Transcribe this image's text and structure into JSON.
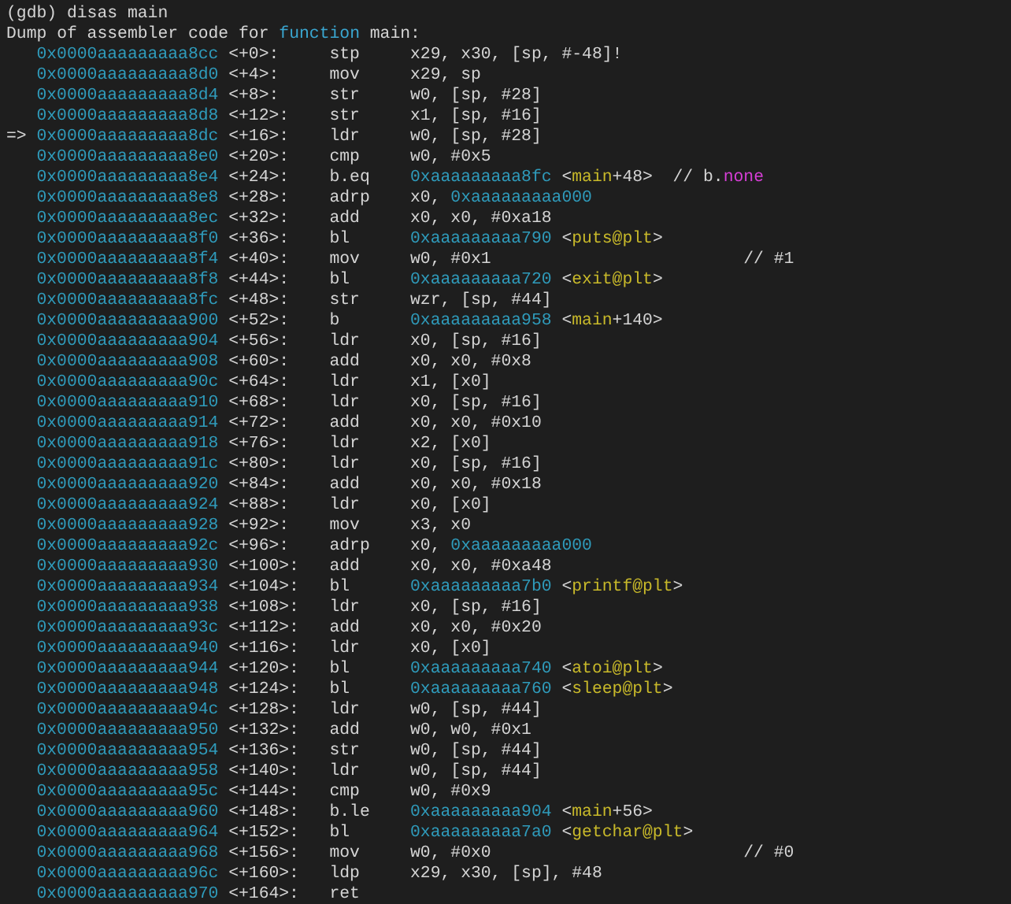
{
  "prompt": "(gdb) disas main",
  "header": [
    {
      "kind": "plain",
      "text": "Dump of assembler code for "
    },
    {
      "kind": "keyword",
      "text": "function"
    },
    {
      "kind": "plain",
      "text": " main:"
    }
  ],
  "instructions": [
    {
      "address": "0x0000aaaaaaaaa8cc",
      "offset": "<+0>:",
      "mnemonic": "stp",
      "operands": [
        {
          "kind": "plain",
          "text": "x29, x30, [sp, #-48]!"
        }
      ]
    },
    {
      "address": "0x0000aaaaaaaaa8d0",
      "offset": "<+4>:",
      "mnemonic": "mov",
      "operands": [
        {
          "kind": "plain",
          "text": "x29, sp"
        }
      ]
    },
    {
      "address": "0x0000aaaaaaaaa8d4",
      "offset": "<+8>:",
      "mnemonic": "str",
      "operands": [
        {
          "kind": "plain",
          "text": "w0, [sp, #28]"
        }
      ]
    },
    {
      "address": "0x0000aaaaaaaaa8d8",
      "offset": "<+12>:",
      "mnemonic": "str",
      "operands": [
        {
          "kind": "plain",
          "text": "x1, [sp, #16]"
        }
      ]
    },
    {
      "pointer": "=>",
      "address": "0x0000aaaaaaaaa8dc",
      "offset": "<+16>:",
      "mnemonic": "ldr",
      "operands": [
        {
          "kind": "plain",
          "text": "w0, [sp, #28]"
        }
      ]
    },
    {
      "address": "0x0000aaaaaaaaa8e0",
      "offset": "<+20>:",
      "mnemonic": "cmp",
      "operands": [
        {
          "kind": "plain",
          "text": "w0, #0x5"
        }
      ]
    },
    {
      "address": "0x0000aaaaaaaaa8e4",
      "offset": "<+24>:",
      "mnemonic": "b.eq",
      "operands": [
        {
          "kind": "address",
          "text": "0xaaaaaaaaa8fc"
        },
        {
          "kind": "plain",
          "text": " <"
        },
        {
          "kind": "symbol",
          "text": "main"
        },
        {
          "kind": "plain",
          "text": "+48>  // b."
        },
        {
          "kind": "condition",
          "text": "none"
        }
      ]
    },
    {
      "address": "0x0000aaaaaaaaa8e8",
      "offset": "<+28>:",
      "mnemonic": "adrp",
      "operands": [
        {
          "kind": "plain",
          "text": "x0, "
        },
        {
          "kind": "address",
          "text": "0xaaaaaaaaa000"
        }
      ]
    },
    {
      "address": "0x0000aaaaaaaaa8ec",
      "offset": "<+32>:",
      "mnemonic": "add",
      "operands": [
        {
          "kind": "plain",
          "text": "x0, x0, #0xa18"
        }
      ]
    },
    {
      "address": "0x0000aaaaaaaaa8f0",
      "offset": "<+36>:",
      "mnemonic": "bl",
      "operands": [
        {
          "kind": "address",
          "text": "0xaaaaaaaaa790"
        },
        {
          "kind": "plain",
          "text": " <"
        },
        {
          "kind": "symbol",
          "text": "puts@plt"
        },
        {
          "kind": "plain",
          "text": ">"
        }
      ]
    },
    {
      "address": "0x0000aaaaaaaaa8f4",
      "offset": "<+40>:",
      "mnemonic": "mov",
      "operands": [
        {
          "kind": "plain",
          "text": "w0, #0x1                         // #1"
        }
      ]
    },
    {
      "address": "0x0000aaaaaaaaa8f8",
      "offset": "<+44>:",
      "mnemonic": "bl",
      "operands": [
        {
          "kind": "address",
          "text": "0xaaaaaaaaa720"
        },
        {
          "kind": "plain",
          "text": " <"
        },
        {
          "kind": "symbol",
          "text": "exit@plt"
        },
        {
          "kind": "plain",
          "text": ">"
        }
      ]
    },
    {
      "address": "0x0000aaaaaaaaa8fc",
      "offset": "<+48>:",
      "mnemonic": "str",
      "operands": [
        {
          "kind": "plain",
          "text": "wzr, [sp, #44]"
        }
      ]
    },
    {
      "address": "0x0000aaaaaaaaa900",
      "offset": "<+52>:",
      "mnemonic": "b",
      "operands": [
        {
          "kind": "address",
          "text": "0xaaaaaaaaa958"
        },
        {
          "kind": "plain",
          "text": " <"
        },
        {
          "kind": "symbol",
          "text": "main"
        },
        {
          "kind": "plain",
          "text": "+140>"
        }
      ]
    },
    {
      "address": "0x0000aaaaaaaaa904",
      "offset": "<+56>:",
      "mnemonic": "ldr",
      "operands": [
        {
          "kind": "plain",
          "text": "x0, [sp, #16]"
        }
      ]
    },
    {
      "address": "0x0000aaaaaaaaa908",
      "offset": "<+60>:",
      "mnemonic": "add",
      "operands": [
        {
          "kind": "plain",
          "text": "x0, x0, #0x8"
        }
      ]
    },
    {
      "address": "0x0000aaaaaaaaa90c",
      "offset": "<+64>:",
      "mnemonic": "ldr",
      "operands": [
        {
          "kind": "plain",
          "text": "x1, [x0]"
        }
      ]
    },
    {
      "address": "0x0000aaaaaaaaa910",
      "offset": "<+68>:",
      "mnemonic": "ldr",
      "operands": [
        {
          "kind": "plain",
          "text": "x0, [sp, #16]"
        }
      ]
    },
    {
      "address": "0x0000aaaaaaaaa914",
      "offset": "<+72>:",
      "mnemonic": "add",
      "operands": [
        {
          "kind": "plain",
          "text": "x0, x0, #0x10"
        }
      ]
    },
    {
      "address": "0x0000aaaaaaaaa918",
      "offset": "<+76>:",
      "mnemonic": "ldr",
      "operands": [
        {
          "kind": "plain",
          "text": "x2, [x0]"
        }
      ]
    },
    {
      "address": "0x0000aaaaaaaaa91c",
      "offset": "<+80>:",
      "mnemonic": "ldr",
      "operands": [
        {
          "kind": "plain",
          "text": "x0, [sp, #16]"
        }
      ]
    },
    {
      "address": "0x0000aaaaaaaaa920",
      "offset": "<+84>:",
      "mnemonic": "add",
      "operands": [
        {
          "kind": "plain",
          "text": "x0, x0, #0x18"
        }
      ]
    },
    {
      "address": "0x0000aaaaaaaaa924",
      "offset": "<+88>:",
      "mnemonic": "ldr",
      "operands": [
        {
          "kind": "plain",
          "text": "x0, [x0]"
        }
      ]
    },
    {
      "address": "0x0000aaaaaaaaa928",
      "offset": "<+92>:",
      "mnemonic": "mov",
      "operands": [
        {
          "kind": "plain",
          "text": "x3, x0"
        }
      ]
    },
    {
      "address": "0x0000aaaaaaaaa92c",
      "offset": "<+96>:",
      "mnemonic": "adrp",
      "operands": [
        {
          "kind": "plain",
          "text": "x0, "
        },
        {
          "kind": "address",
          "text": "0xaaaaaaaaa000"
        }
      ]
    },
    {
      "address": "0x0000aaaaaaaaa930",
      "offset": "<+100>:",
      "mnemonic": "add",
      "operands": [
        {
          "kind": "plain",
          "text": "x0, x0, #0xa48"
        }
      ]
    },
    {
      "address": "0x0000aaaaaaaaa934",
      "offset": "<+104>:",
      "mnemonic": "bl",
      "operands": [
        {
          "kind": "address",
          "text": "0xaaaaaaaaa7b0"
        },
        {
          "kind": "plain",
          "text": " <"
        },
        {
          "kind": "symbol",
          "text": "printf@plt"
        },
        {
          "kind": "plain",
          "text": ">"
        }
      ]
    },
    {
      "address": "0x0000aaaaaaaaa938",
      "offset": "<+108>:",
      "mnemonic": "ldr",
      "operands": [
        {
          "kind": "plain",
          "text": "x0, [sp, #16]"
        }
      ]
    },
    {
      "address": "0x0000aaaaaaaaa93c",
      "offset": "<+112>:",
      "mnemonic": "add",
      "operands": [
        {
          "kind": "plain",
          "text": "x0, x0, #0x20"
        }
      ]
    },
    {
      "address": "0x0000aaaaaaaaa940",
      "offset": "<+116>:",
      "mnemonic": "ldr",
      "operands": [
        {
          "kind": "plain",
          "text": "x0, [x0]"
        }
      ]
    },
    {
      "address": "0x0000aaaaaaaaa944",
      "offset": "<+120>:",
      "mnemonic": "bl",
      "operands": [
        {
          "kind": "address",
          "text": "0xaaaaaaaaa740"
        },
        {
          "kind": "plain",
          "text": " <"
        },
        {
          "kind": "symbol",
          "text": "atoi@plt"
        },
        {
          "kind": "plain",
          "text": ">"
        }
      ]
    },
    {
      "address": "0x0000aaaaaaaaa948",
      "offset": "<+124>:",
      "mnemonic": "bl",
      "operands": [
        {
          "kind": "address",
          "text": "0xaaaaaaaaa760"
        },
        {
          "kind": "plain",
          "text": " <"
        },
        {
          "kind": "symbol",
          "text": "sleep@plt"
        },
        {
          "kind": "plain",
          "text": ">"
        }
      ]
    },
    {
      "address": "0x0000aaaaaaaaa94c",
      "offset": "<+128>:",
      "mnemonic": "ldr",
      "operands": [
        {
          "kind": "plain",
          "text": "w0, [sp, #44]"
        }
      ]
    },
    {
      "address": "0x0000aaaaaaaaa950",
      "offset": "<+132>:",
      "mnemonic": "add",
      "operands": [
        {
          "kind": "plain",
          "text": "w0, w0, #0x1"
        }
      ]
    },
    {
      "address": "0x0000aaaaaaaaa954",
      "offset": "<+136>:",
      "mnemonic": "str",
      "operands": [
        {
          "kind": "plain",
          "text": "w0, [sp, #44]"
        }
      ]
    },
    {
      "address": "0x0000aaaaaaaaa958",
      "offset": "<+140>:",
      "mnemonic": "ldr",
      "operands": [
        {
          "kind": "plain",
          "text": "w0, [sp, #44]"
        }
      ]
    },
    {
      "address": "0x0000aaaaaaaaa95c",
      "offset": "<+144>:",
      "mnemonic": "cmp",
      "operands": [
        {
          "kind": "plain",
          "text": "w0, #0x9"
        }
      ]
    },
    {
      "address": "0x0000aaaaaaaaa960",
      "offset": "<+148>:",
      "mnemonic": "b.le",
      "operands": [
        {
          "kind": "address",
          "text": "0xaaaaaaaaa904"
        },
        {
          "kind": "plain",
          "text": " <"
        },
        {
          "kind": "symbol",
          "text": "main"
        },
        {
          "kind": "plain",
          "text": "+56>"
        }
      ]
    },
    {
      "address": "0x0000aaaaaaaaa964",
      "offset": "<+152>:",
      "mnemonic": "bl",
      "operands": [
        {
          "kind": "address",
          "text": "0xaaaaaaaaa7a0"
        },
        {
          "kind": "plain",
          "text": " <"
        },
        {
          "kind": "symbol",
          "text": "getchar@plt"
        },
        {
          "kind": "plain",
          "text": ">"
        }
      ]
    },
    {
      "address": "0x0000aaaaaaaaa968",
      "offset": "<+156>:",
      "mnemonic": "mov",
      "operands": [
        {
          "kind": "plain",
          "text": "w0, #0x0                         // #0"
        }
      ]
    },
    {
      "address": "0x0000aaaaaaaaa96c",
      "offset": "<+160>:",
      "mnemonic": "ldp",
      "operands": [
        {
          "kind": "plain",
          "text": "x29, x30, [sp], #48"
        }
      ]
    },
    {
      "address": "0x0000aaaaaaaaa970",
      "offset": "<+164>:",
      "mnemonic": "ret"
    }
  ]
}
